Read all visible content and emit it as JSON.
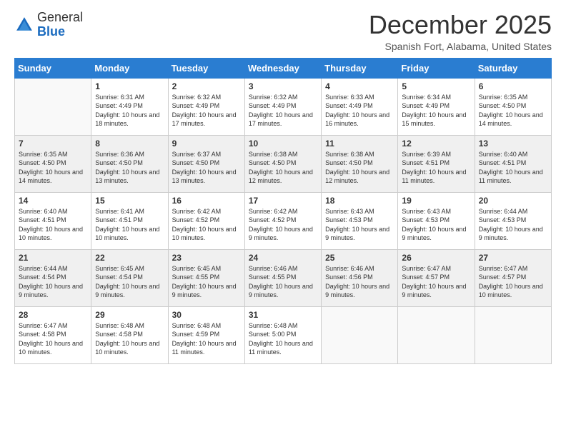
{
  "logo": {
    "general": "General",
    "blue": "Blue"
  },
  "header": {
    "month": "December 2025",
    "location": "Spanish Fort, Alabama, United States"
  },
  "weekdays": [
    "Sunday",
    "Monday",
    "Tuesday",
    "Wednesday",
    "Thursday",
    "Friday",
    "Saturday"
  ],
  "weeks": [
    [
      {
        "day": "",
        "sunrise": "",
        "sunset": "",
        "daylight": ""
      },
      {
        "day": "1",
        "sunrise": "Sunrise: 6:31 AM",
        "sunset": "Sunset: 4:49 PM",
        "daylight": "Daylight: 10 hours and 18 minutes."
      },
      {
        "day": "2",
        "sunrise": "Sunrise: 6:32 AM",
        "sunset": "Sunset: 4:49 PM",
        "daylight": "Daylight: 10 hours and 17 minutes."
      },
      {
        "day": "3",
        "sunrise": "Sunrise: 6:32 AM",
        "sunset": "Sunset: 4:49 PM",
        "daylight": "Daylight: 10 hours and 17 minutes."
      },
      {
        "day": "4",
        "sunrise": "Sunrise: 6:33 AM",
        "sunset": "Sunset: 4:49 PM",
        "daylight": "Daylight: 10 hours and 16 minutes."
      },
      {
        "day": "5",
        "sunrise": "Sunrise: 6:34 AM",
        "sunset": "Sunset: 4:49 PM",
        "daylight": "Daylight: 10 hours and 15 minutes."
      },
      {
        "day": "6",
        "sunrise": "Sunrise: 6:35 AM",
        "sunset": "Sunset: 4:50 PM",
        "daylight": "Daylight: 10 hours and 14 minutes."
      }
    ],
    [
      {
        "day": "7",
        "sunrise": "Sunrise: 6:35 AM",
        "sunset": "Sunset: 4:50 PM",
        "daylight": "Daylight: 10 hours and 14 minutes."
      },
      {
        "day": "8",
        "sunrise": "Sunrise: 6:36 AM",
        "sunset": "Sunset: 4:50 PM",
        "daylight": "Daylight: 10 hours and 13 minutes."
      },
      {
        "day": "9",
        "sunrise": "Sunrise: 6:37 AM",
        "sunset": "Sunset: 4:50 PM",
        "daylight": "Daylight: 10 hours and 13 minutes."
      },
      {
        "day": "10",
        "sunrise": "Sunrise: 6:38 AM",
        "sunset": "Sunset: 4:50 PM",
        "daylight": "Daylight: 10 hours and 12 minutes."
      },
      {
        "day": "11",
        "sunrise": "Sunrise: 6:38 AM",
        "sunset": "Sunset: 4:50 PM",
        "daylight": "Daylight: 10 hours and 12 minutes."
      },
      {
        "day": "12",
        "sunrise": "Sunrise: 6:39 AM",
        "sunset": "Sunset: 4:51 PM",
        "daylight": "Daylight: 10 hours and 11 minutes."
      },
      {
        "day": "13",
        "sunrise": "Sunrise: 6:40 AM",
        "sunset": "Sunset: 4:51 PM",
        "daylight": "Daylight: 10 hours and 11 minutes."
      }
    ],
    [
      {
        "day": "14",
        "sunrise": "Sunrise: 6:40 AM",
        "sunset": "Sunset: 4:51 PM",
        "daylight": "Daylight: 10 hours and 10 minutes."
      },
      {
        "day": "15",
        "sunrise": "Sunrise: 6:41 AM",
        "sunset": "Sunset: 4:51 PM",
        "daylight": "Daylight: 10 hours and 10 minutes."
      },
      {
        "day": "16",
        "sunrise": "Sunrise: 6:42 AM",
        "sunset": "Sunset: 4:52 PM",
        "daylight": "Daylight: 10 hours and 10 minutes."
      },
      {
        "day": "17",
        "sunrise": "Sunrise: 6:42 AM",
        "sunset": "Sunset: 4:52 PM",
        "daylight": "Daylight: 10 hours and 9 minutes."
      },
      {
        "day": "18",
        "sunrise": "Sunrise: 6:43 AM",
        "sunset": "Sunset: 4:53 PM",
        "daylight": "Daylight: 10 hours and 9 minutes."
      },
      {
        "day": "19",
        "sunrise": "Sunrise: 6:43 AM",
        "sunset": "Sunset: 4:53 PM",
        "daylight": "Daylight: 10 hours and 9 minutes."
      },
      {
        "day": "20",
        "sunrise": "Sunrise: 6:44 AM",
        "sunset": "Sunset: 4:53 PM",
        "daylight": "Daylight: 10 hours and 9 minutes."
      }
    ],
    [
      {
        "day": "21",
        "sunrise": "Sunrise: 6:44 AM",
        "sunset": "Sunset: 4:54 PM",
        "daylight": "Daylight: 10 hours and 9 minutes."
      },
      {
        "day": "22",
        "sunrise": "Sunrise: 6:45 AM",
        "sunset": "Sunset: 4:54 PM",
        "daylight": "Daylight: 10 hours and 9 minutes."
      },
      {
        "day": "23",
        "sunrise": "Sunrise: 6:45 AM",
        "sunset": "Sunset: 4:55 PM",
        "daylight": "Daylight: 10 hours and 9 minutes."
      },
      {
        "day": "24",
        "sunrise": "Sunrise: 6:46 AM",
        "sunset": "Sunset: 4:55 PM",
        "daylight": "Daylight: 10 hours and 9 minutes."
      },
      {
        "day": "25",
        "sunrise": "Sunrise: 6:46 AM",
        "sunset": "Sunset: 4:56 PM",
        "daylight": "Daylight: 10 hours and 9 minutes."
      },
      {
        "day": "26",
        "sunrise": "Sunrise: 6:47 AM",
        "sunset": "Sunset: 4:57 PM",
        "daylight": "Daylight: 10 hours and 9 minutes."
      },
      {
        "day": "27",
        "sunrise": "Sunrise: 6:47 AM",
        "sunset": "Sunset: 4:57 PM",
        "daylight": "Daylight: 10 hours and 10 minutes."
      }
    ],
    [
      {
        "day": "28",
        "sunrise": "Sunrise: 6:47 AM",
        "sunset": "Sunset: 4:58 PM",
        "daylight": "Daylight: 10 hours and 10 minutes."
      },
      {
        "day": "29",
        "sunrise": "Sunrise: 6:48 AM",
        "sunset": "Sunset: 4:58 PM",
        "daylight": "Daylight: 10 hours and 10 minutes."
      },
      {
        "day": "30",
        "sunrise": "Sunrise: 6:48 AM",
        "sunset": "Sunset: 4:59 PM",
        "daylight": "Daylight: 10 hours and 11 minutes."
      },
      {
        "day": "31",
        "sunrise": "Sunrise: 6:48 AM",
        "sunset": "Sunset: 5:00 PM",
        "daylight": "Daylight: 10 hours and 11 minutes."
      },
      {
        "day": "",
        "sunrise": "",
        "sunset": "",
        "daylight": ""
      },
      {
        "day": "",
        "sunrise": "",
        "sunset": "",
        "daylight": ""
      },
      {
        "day": "",
        "sunrise": "",
        "sunset": "",
        "daylight": ""
      }
    ]
  ]
}
